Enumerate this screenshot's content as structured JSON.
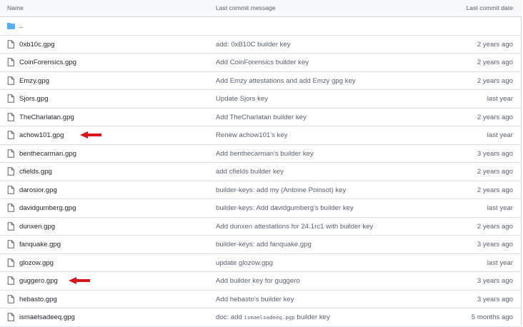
{
  "header": {
    "name": "Name",
    "message": "Last commit message",
    "date": "Last commit date"
  },
  "parent_dir": {
    "label": ".."
  },
  "files": [
    {
      "name": "0xb10c.gpg",
      "message": "add: 0xB10C builder key",
      "date": "2 years ago"
    },
    {
      "name": "CoinForensics.gpg",
      "message": "Add CoinForensics builder key",
      "date": "2 years ago"
    },
    {
      "name": "Emzy.gpg",
      "message": "Add Emzy attestations and add Emzy gpg key",
      "date": "2 years ago"
    },
    {
      "name": "Sjors.gpg",
      "message": "Update Sjors key",
      "date": "last year"
    },
    {
      "name": "TheCharlatan.gpg",
      "message": "Add TheCharlatan builder key",
      "date": "2 years ago"
    },
    {
      "name": "achow101.gpg",
      "message": "Renew achow101's key",
      "date": "last year"
    },
    {
      "name": "benthecarman.gpg",
      "message": "Add benthecarman's builder key",
      "date": "3 years ago"
    },
    {
      "name": "cfields.gpg",
      "message": "add cfields builder key",
      "date": "2 years ago"
    },
    {
      "name": "darosior.gpg",
      "message": "builder-keys: add my (Antoine Poinsot) key",
      "date": "2 years ago"
    },
    {
      "name": "davidgumberg.gpg",
      "message": "builder-keys: Add davidgumberg's builder key",
      "date": "last year"
    },
    {
      "name": "dunxen.gpg",
      "message": "Add dunxen attestations for 24.1rc1 with builder key",
      "date": "2 years ago"
    },
    {
      "name": "fanquake.gpg",
      "message": "builder-keys: add fanquake.gpg",
      "date": "3 years ago"
    },
    {
      "name": "glozow.gpg",
      "message": "update glozow.gpg",
      "date": "last year"
    },
    {
      "name": "guggero.gpg",
      "message": "Add builder key for guggero",
      "date": "3 years ago"
    },
    {
      "name": "hebasto.gpg",
      "message": "Add hebasto's builder key",
      "date": "3 years ago"
    },
    {
      "name": "ismaelsadeeq.gpg",
      "message_prefix": "doc: add ",
      "message_code": "ismaelsadeeq.pgp",
      "message_suffix": " builder key",
      "date": "5 months ago"
    }
  ],
  "colors": {
    "folder": "#54aeff",
    "file_icon": "#59636e",
    "annotation_arrow": "#d9141b",
    "border": "#d0d7de",
    "header_bg": "#f6f8fa"
  },
  "annotations": [
    {
      "type": "red-arrow",
      "points_to": "achow101.gpg"
    },
    {
      "type": "red-arrow",
      "points_to": "guggero.gpg"
    }
  ]
}
